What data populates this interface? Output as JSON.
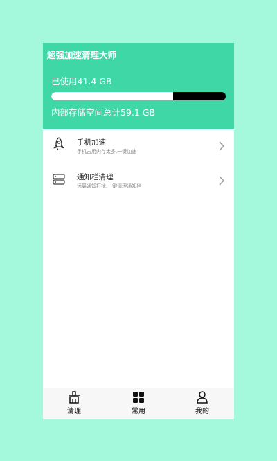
{
  "header": {
    "title": "超强加速清理大师",
    "used_text": "已使用41.4 GB",
    "total_text": "内部存储空间总计59.1 GB",
    "usage_fraction": 0.7
  },
  "menu": [
    {
      "title": "手机加速",
      "subtitle": "手机占用内存太多,一键加速",
      "icon": "rocket-icon"
    },
    {
      "title": "通知栏清理",
      "subtitle": "远离通知打扰,一键清理通知栏",
      "icon": "notification-icon"
    }
  ],
  "tabs": [
    {
      "label": "清理",
      "icon": "broom-icon"
    },
    {
      "label": "常用",
      "icon": "grid-icon"
    },
    {
      "label": "我的",
      "icon": "user-icon"
    }
  ],
  "colors": {
    "background": "#a4f8dc",
    "header": "#40d7a6",
    "bar_track": "#000000",
    "bar_fill": "#ffffff"
  }
}
